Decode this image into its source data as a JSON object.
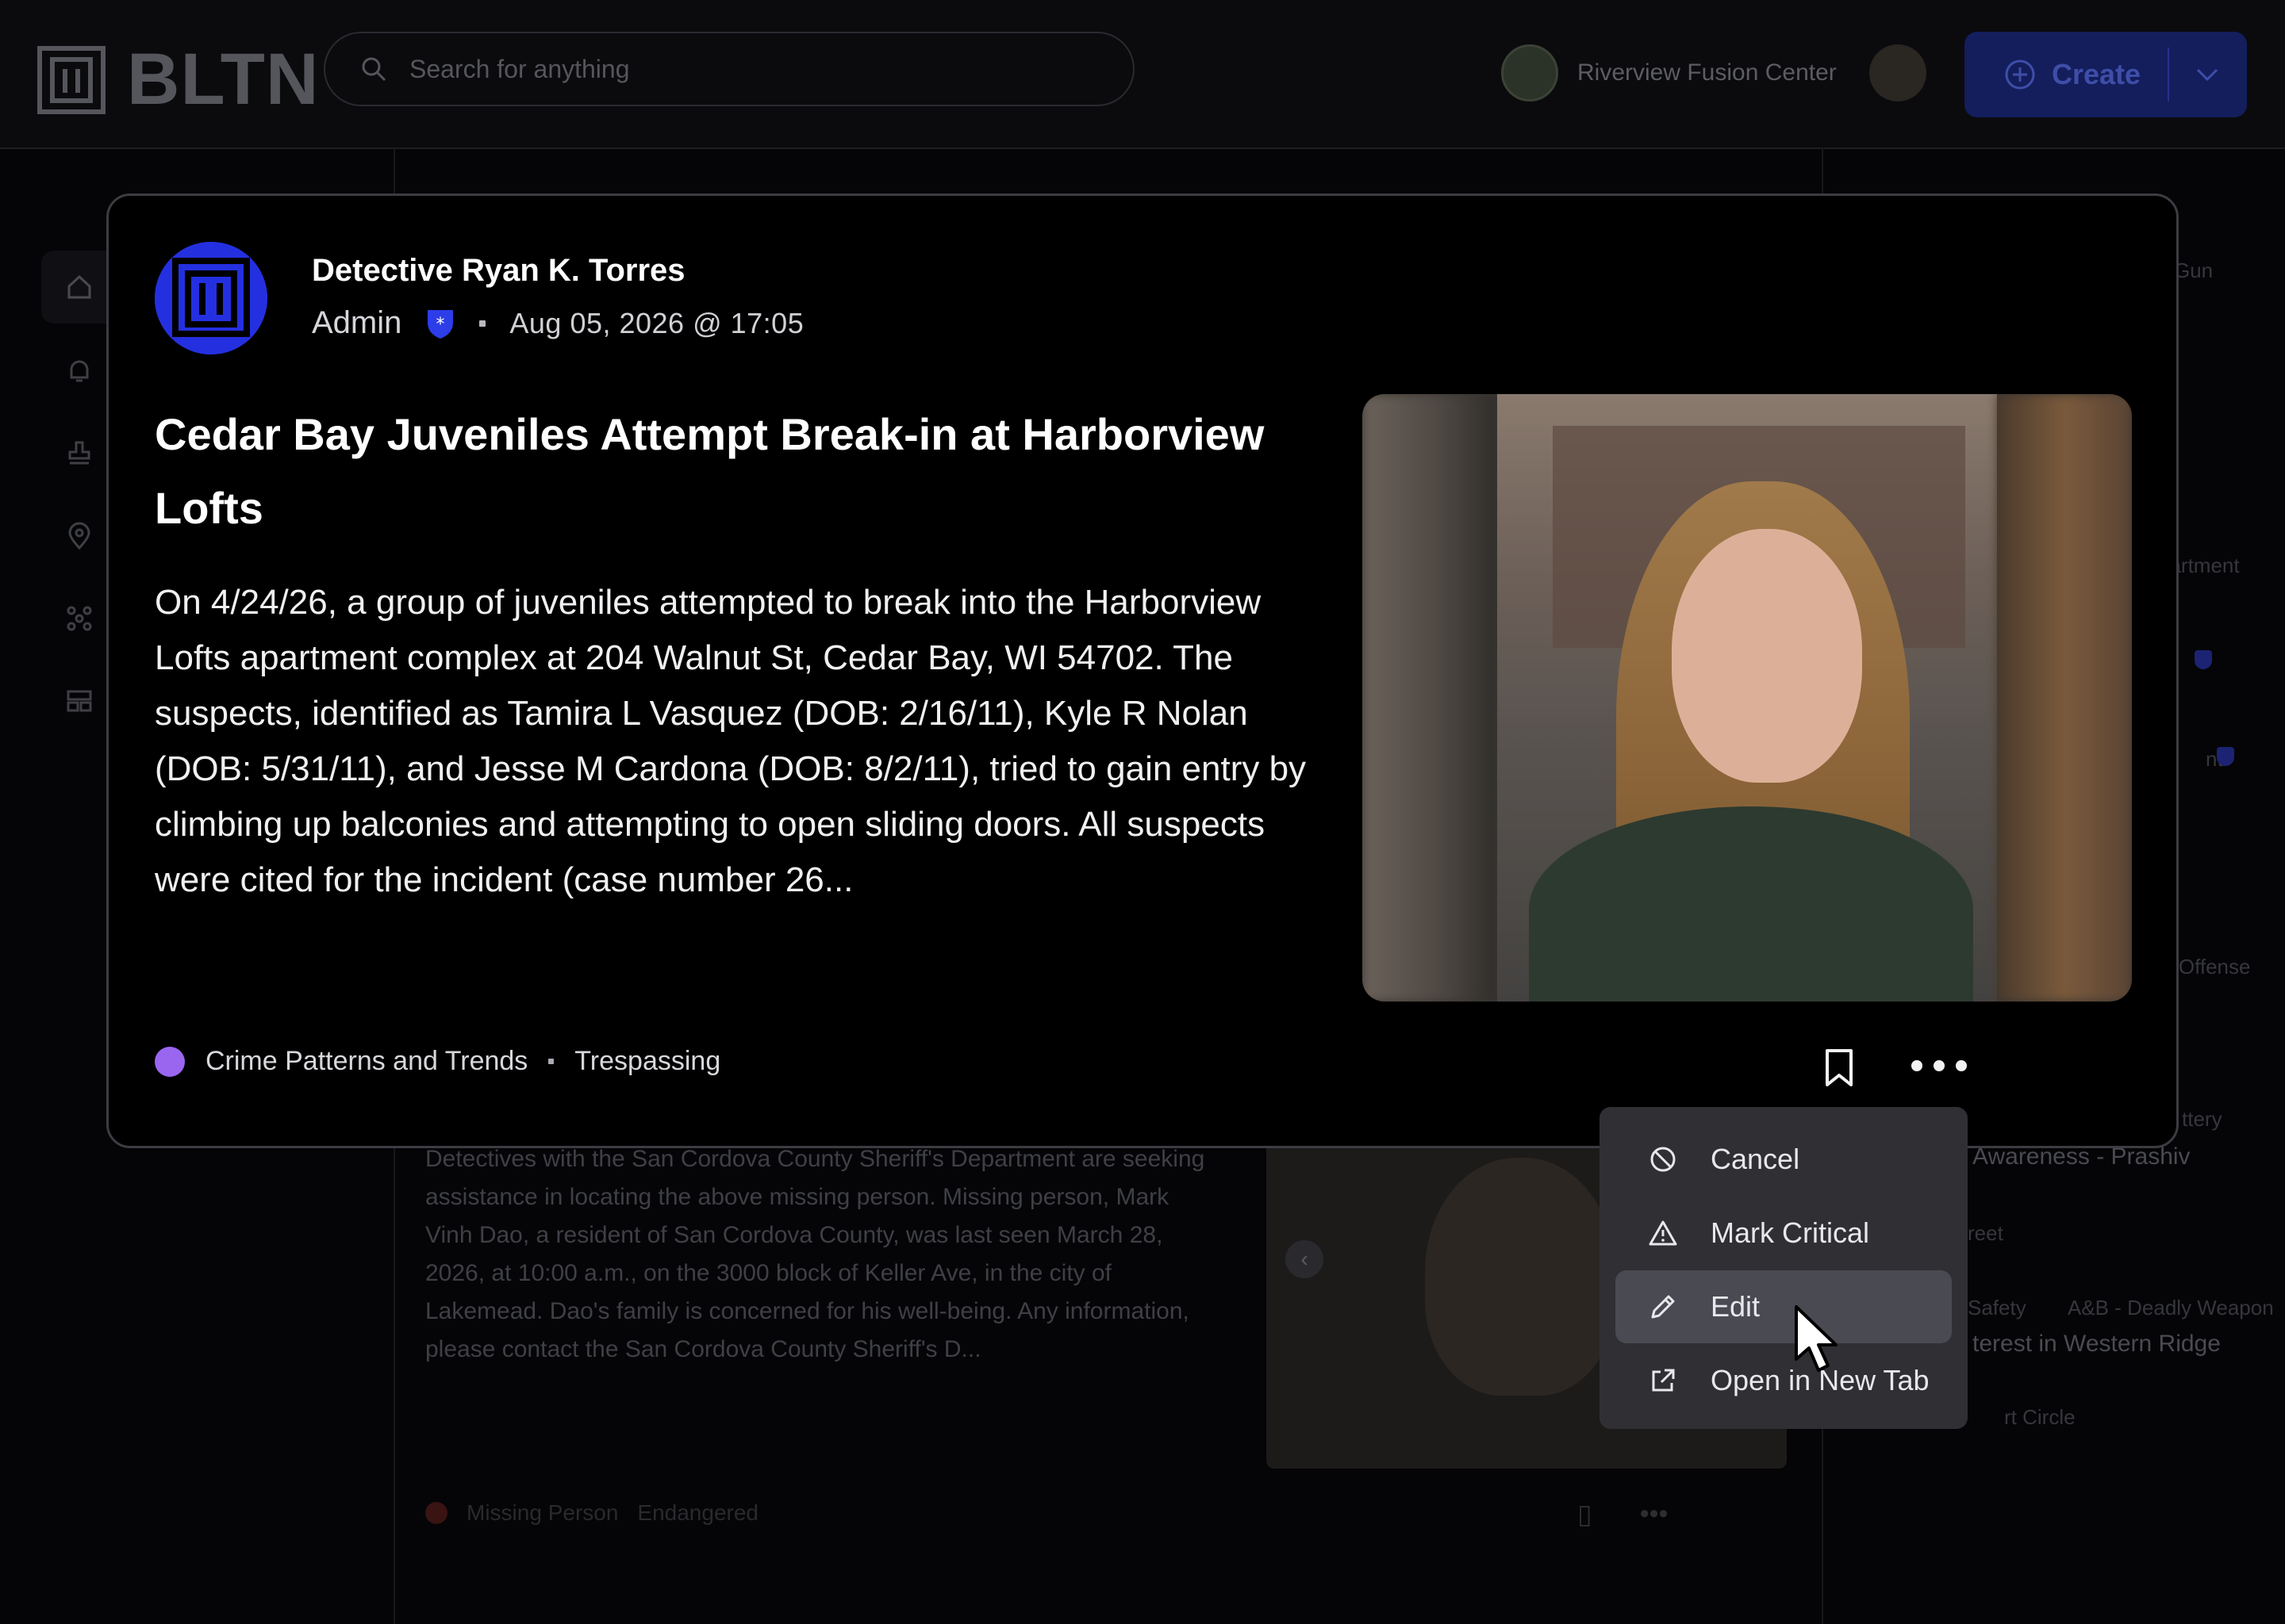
{
  "app": {
    "brand": "BLTN",
    "search_placeholder": "Search for anything",
    "org_name": "Riverview Fusion Center",
    "create_label": "Create"
  },
  "post": {
    "author_name": "Detective Ryan K. Torres",
    "author_role": "Admin",
    "timestamp": "Aug 05, 2026 @ 17:05",
    "title": "Cedar Bay Juveniles Attempt Break-in at Harborview Lofts",
    "body": "On 4/24/26, a group of juveniles attempted to break into the Harborview Lofts apartment complex at 204 Walnut St, Cedar Bay, WI 54702. The suspects, identified as Tamira L Vasquez (DOB: 2/16/11), Kyle R Nolan (DOB: 5/31/11), and Jesse M Cardona (DOB: 8/2/11), tried to gain entry by climbing up balconies and attempting to open sliding doors. All suspects were cited for the incident (case number 26...",
    "category": "Crime Patterns and Trends",
    "category_color": "#9a66f0",
    "tag": "Trespassing"
  },
  "menu": {
    "items": [
      {
        "label": "Cancel",
        "icon": "ban-icon"
      },
      {
        "label": "Mark Critical",
        "icon": "warning-icon"
      },
      {
        "label": "Edit",
        "icon": "pencil-icon"
      },
      {
        "label": "Open in New Tab",
        "icon": "external-link-icon"
      }
    ],
    "hovered": "Edit"
  },
  "background": {
    "post_body": "Detectives with the San Cordova County Sheriff's Department are seeking assistance in locating the above missing person. Missing person, Mark Vinh Dao, a resident of San Cordova County, was last seen March 28, 2026, at 10:00 a.m., on the 3000 block of Keller Ave, in the city of Lakemead. Dao's family is concerned for his well-being. Any information, please contact the San Cordova County Sheriff's D...",
    "post_category": "Missing Person",
    "post_tag": "Endangered",
    "sidebar": [
      "Gun",
      "partment",
      "nt",
      "r Offense",
      "ttery",
      "Awareness - Prashiv",
      "reet",
      "Safety",
      "A&B - Deadly Weapon",
      "terest in Western Ridge",
      "rt Circle"
    ]
  },
  "colors": {
    "accent": "#2430e0",
    "badge": "#2d3de8",
    "card_border": "#3c3c42",
    "menu_bg": "#303034"
  }
}
